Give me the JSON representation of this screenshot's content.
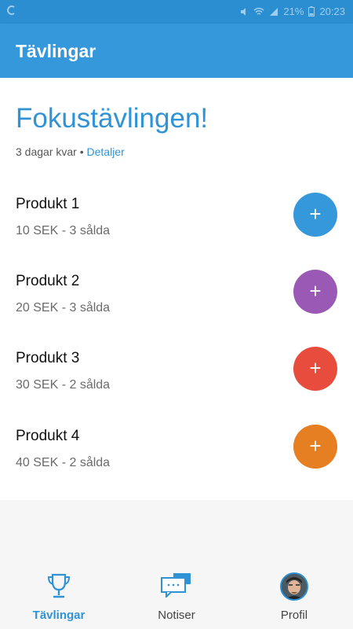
{
  "statusbar": {
    "battery": "21%",
    "time": "20:23"
  },
  "appbar": {
    "title": "Tävlingar"
  },
  "competition": {
    "title": "Fokustävlingen!",
    "remaining": "3 dagar kvar",
    "separator": "•",
    "details_link": "Detaljer"
  },
  "products": [
    {
      "name": "Produkt 1",
      "meta": "10 SEK - 3 sålda",
      "color": "#3498db",
      "add_label": "+"
    },
    {
      "name": "Produkt 2",
      "meta": "20 SEK - 3 sålda",
      "color": "#9b59b6",
      "add_label": "+"
    },
    {
      "name": "Produkt 3",
      "meta": "30 SEK - 2 sålda",
      "color": "#e74c3c",
      "add_label": "+"
    },
    {
      "name": "Produkt 4",
      "meta": "40 SEK - 2 sålda",
      "color": "#e67e22",
      "add_label": "+"
    }
  ],
  "nav": {
    "items": [
      {
        "label": "Tävlingar",
        "icon": "trophy-icon",
        "active": true
      },
      {
        "label": "Notiser",
        "icon": "chat-icon",
        "active": false
      },
      {
        "label": "Profil",
        "icon": "avatar",
        "active": false
      }
    ]
  },
  "colors": {
    "accent": "#3498db",
    "status_bar": "#2b8ed1"
  }
}
